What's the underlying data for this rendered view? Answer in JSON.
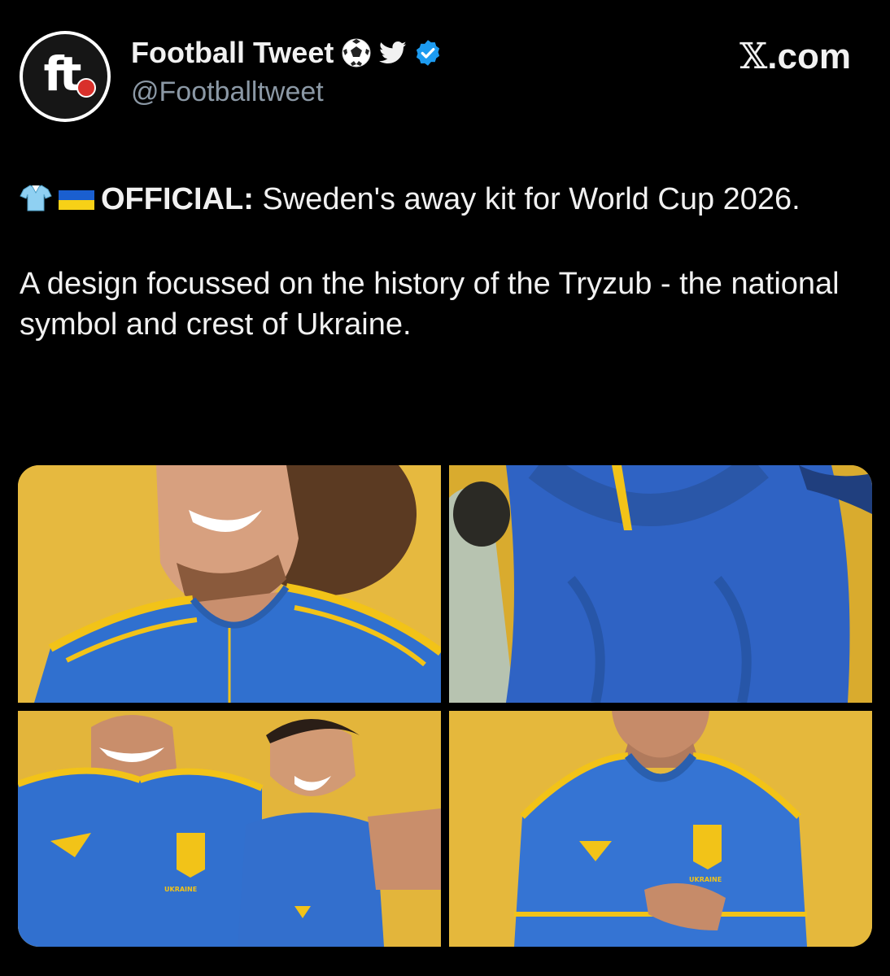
{
  "header": {
    "display_name": "Football Tweet",
    "handle": "@Footballtweet",
    "site_x": "𝕏",
    "site_suffix": ".com",
    "name_emojis": [
      "football-icon",
      "bird-icon",
      "verified-badge-icon"
    ]
  },
  "tweet": {
    "emojis": [
      "tshirt-icon",
      "ukraine-flag-icon"
    ],
    "bold_lead": "OFFICIAL:",
    "line1_rest": " Sweden's away kit for World Cup 2026.",
    "paragraph2": "A design focussed on the history of the Tryzub - the national symbol and crest of Ukraine."
  },
  "media": {
    "photos": [
      {
        "id": "photo-1"
      },
      {
        "id": "photo-2"
      },
      {
        "id": "photo-3",
        "kit_label": "UKRAINE"
      },
      {
        "id": "photo-4",
        "kit_label": "UKRAINE"
      }
    ]
  },
  "colors": {
    "background": "#000000",
    "text": "#f1f1f1",
    "muted": "#8b98a5",
    "verified": "#1d9bf0",
    "kit_blue": "#2f6fd0",
    "kit_yellow": "#f2c318",
    "backdrop_yellow": "#e5b83c"
  }
}
